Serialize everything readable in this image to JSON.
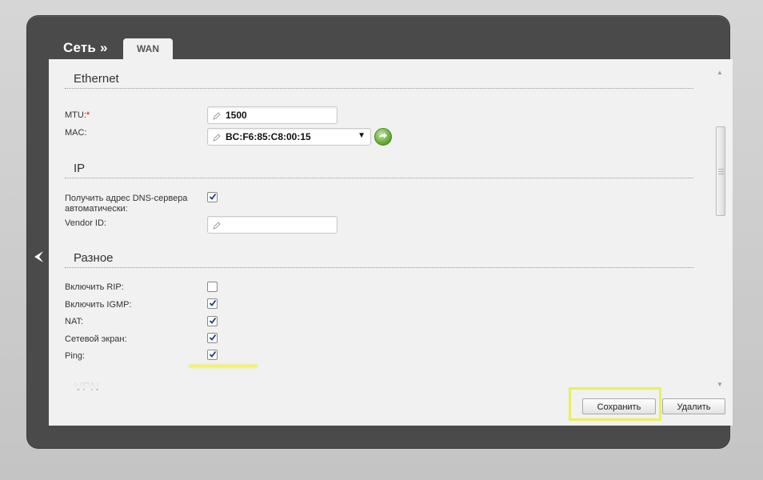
{
  "header": {
    "title": "Сеть »",
    "tab_label": "WAN"
  },
  "sections": {
    "ethernet": {
      "title": "Ethernet",
      "mtu_label": "MTU:",
      "mtu_required": "*",
      "mtu_value": "1500",
      "mac_label": "MAC:",
      "mac_value": "BC:F6:85:C8:00:15"
    },
    "ip": {
      "title": "IP",
      "dns_label_line1": "Получить адрес DNS-сервера",
      "dns_label_line2": "автоматически:",
      "dns_checked": true,
      "vendor_label": "Vendor ID:",
      "vendor_value": ""
    },
    "misc": {
      "title": "Разное",
      "items": [
        {
          "label": "Включить RIP:",
          "checked": false
        },
        {
          "label": "Включить IGMP:",
          "checked": true
        },
        {
          "label": "NAT:",
          "checked": true
        },
        {
          "label": "Сетевой экран:",
          "checked": true
        },
        {
          "label": "Ping:",
          "checked": true
        }
      ]
    },
    "vpn": {
      "title": "VPN"
    }
  },
  "buttons": {
    "save": "Сохранить",
    "delete": "Удалить"
  },
  "icons": {
    "back": "chevron-left-icon",
    "pencil": "pencil-icon",
    "dropdown": "caret-down-icon",
    "go": "refresh-arrow-icon",
    "check": "check-icon"
  },
  "colors": {
    "frame": "#4a4a4a",
    "panel": "#f1f1f1",
    "required": "#dd0000",
    "highlight": "#eaf05a",
    "go_button": "#5aa22a"
  }
}
